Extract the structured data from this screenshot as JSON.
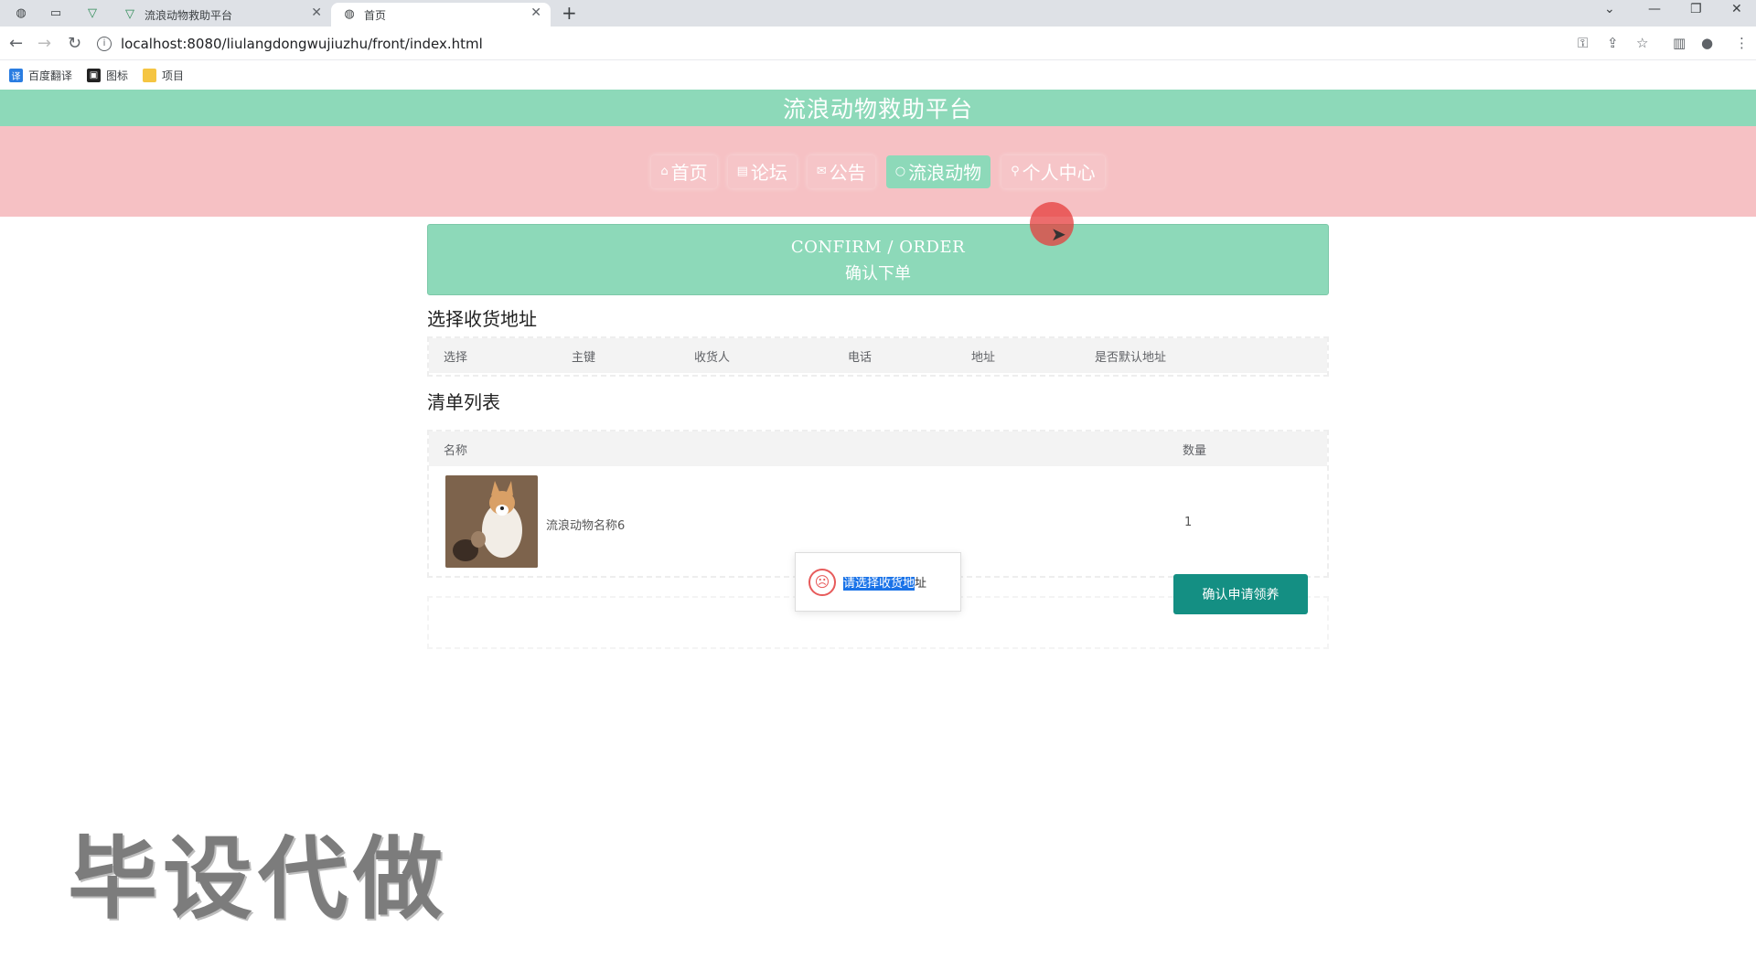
{
  "browser": {
    "tabs": [
      {
        "title": "流浪动物救助平台",
        "active": false
      },
      {
        "title": "首页",
        "active": true
      }
    ],
    "url": "localhost:8080/liulangdongwujiuzhu/front/index.html",
    "bookmarks": [
      "百度翻译",
      "图标",
      "项目"
    ]
  },
  "site": {
    "title": "流浪动物救助平台"
  },
  "menu": [
    {
      "icon": "home-icon",
      "label": "首页",
      "glyph": "⌂",
      "active": false
    },
    {
      "icon": "forum-icon",
      "label": "论坛",
      "glyph": "▤",
      "active": false
    },
    {
      "icon": "notice-icon",
      "label": "公告",
      "glyph": "✉",
      "active": false
    },
    {
      "icon": "animal-icon",
      "label": "流浪动物",
      "glyph": "○",
      "active": true
    },
    {
      "icon": "user-icon",
      "label": "个人中心",
      "glyph": "⚲",
      "active": false
    }
  ],
  "banner": {
    "en": "CONFIRM / ORDER",
    "zh": "确认下单"
  },
  "address": {
    "title": "选择收货地址",
    "columns": [
      "选择",
      "主键",
      "收货人",
      "电话",
      "地址",
      "是否默认地址"
    ]
  },
  "list": {
    "title": "清单列表",
    "columns": [
      "名称",
      "数量"
    ],
    "rows": [
      {
        "name": "流浪动物名称6",
        "qty": "1"
      }
    ]
  },
  "confirm_button": "确认申请领养",
  "toast": {
    "selected": "请选择收货地",
    "rest": "址"
  },
  "watermark": "毕设代做",
  "colors": {
    "header": "#8dd9b9",
    "menu": "#f6c1c4",
    "button": "#148f83",
    "error": "#e75b5b"
  }
}
